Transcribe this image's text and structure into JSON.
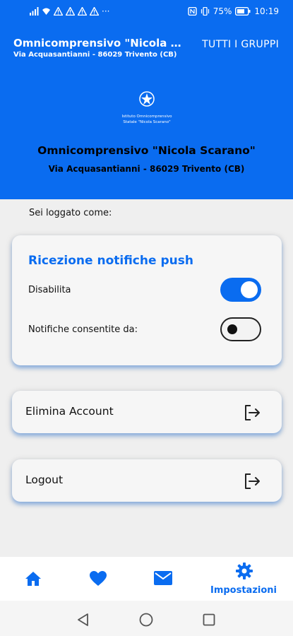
{
  "status_bar": {
    "dots": "···",
    "battery": "75%",
    "time": "10:19"
  },
  "header": {
    "title": "Omnicomprensivo \"Nicola Scarano\"",
    "address": "Via Acquasantianni - 86029 Trivento (CB)",
    "groups_button": "TUTTI I GRUPPI"
  },
  "school": {
    "logo_text_line1": "Istituto Omnicomprensivo",
    "logo_text_line2": "Statale \"Nicola Scarano\"",
    "name": "Omnicomprensivo \"Nicola Scarano\"",
    "address": "Via Acquasantianni - 86029 Trivento (CB)"
  },
  "logged_as": "Sei loggato come:",
  "push": {
    "title": "Ricezione notifiche push",
    "disable_label": "Disabilita",
    "disable_on": true,
    "allowed_label": "Notifiche consentite da:",
    "allowed_on": false
  },
  "actions": {
    "delete_account": "Elimina Account",
    "logout": "Logout"
  },
  "bottom_nav": {
    "items": [
      {
        "icon": "home-icon"
      },
      {
        "icon": "heart-icon"
      },
      {
        "icon": "mail-icon"
      },
      {
        "icon": "gear-icon",
        "label": "Impostazioni",
        "active": true
      }
    ]
  },
  "colors": {
    "primary": "#0a6cf0",
    "background": "#efefef"
  }
}
